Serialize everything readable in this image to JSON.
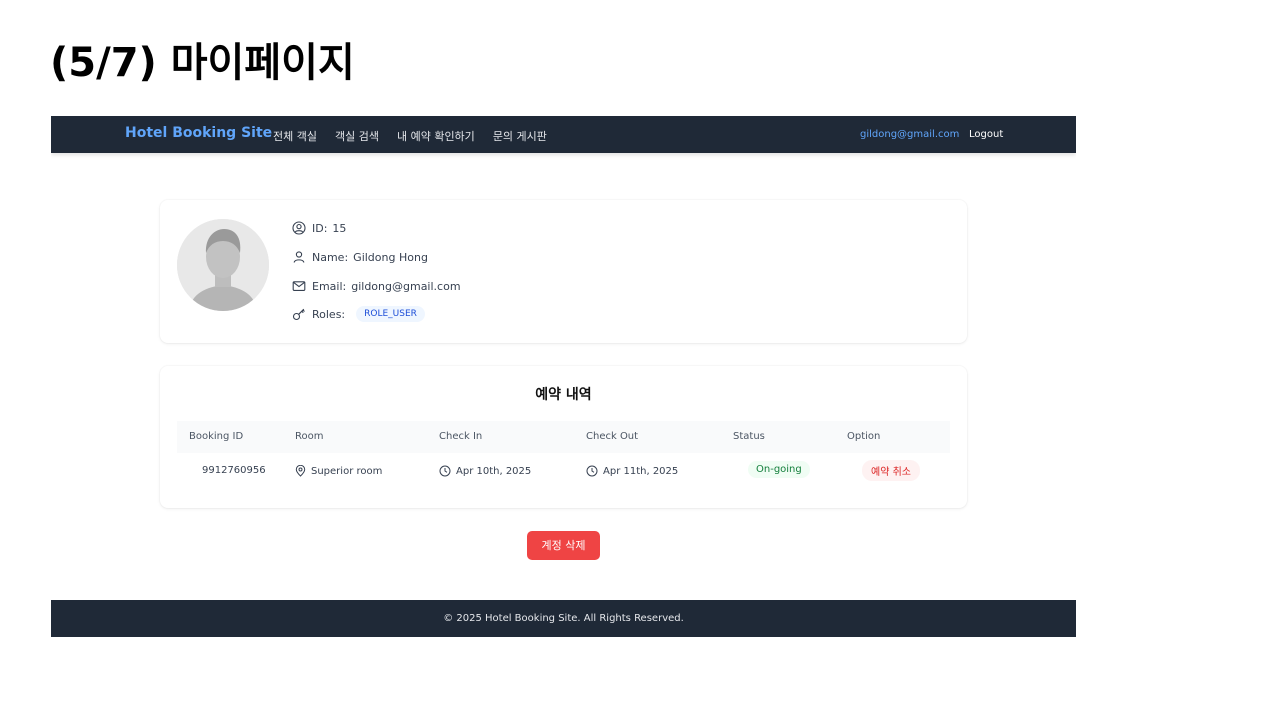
{
  "slide": {
    "title": "(5/7) 마이페이지"
  },
  "navbar": {
    "brand": "Hotel Booking Site",
    "links": [
      "전체 객실",
      "객실 검색",
      "내 예약 확인하기",
      "문의 게시판"
    ],
    "email": "gildong@gmail.com",
    "logout": "Logout"
  },
  "profile": {
    "id_label": "ID:",
    "id_value": "15",
    "name_label": "Name:",
    "name_value": "Gildong Hong",
    "email_label": "Email:",
    "email_value": "gildong@gmail.com",
    "roles_label": "Roles:",
    "role": "ROLE_USER"
  },
  "bookings": {
    "title": "예약 내역",
    "columns": [
      "Booking ID",
      "Room",
      "Check In",
      "Check Out",
      "Status",
      "Option"
    ],
    "rows": [
      {
        "booking_id": "9912760956",
        "room": "Superior room",
        "check_in": "Apr 10th, 2025",
        "check_out": "Apr 11th, 2025",
        "status": "On-going",
        "option": "예약 취소"
      }
    ]
  },
  "account": {
    "delete_label": "계정 삭제"
  },
  "footer": {
    "text": "© 2025 Hotel Booking Site. All Rights Reserved."
  },
  "colors": {
    "navbar_bg": "#1f2937",
    "brand": "#60a5fa",
    "delete_button": "#ef4444",
    "status_green": "#15803d",
    "cancel_red": "#dc2626"
  }
}
